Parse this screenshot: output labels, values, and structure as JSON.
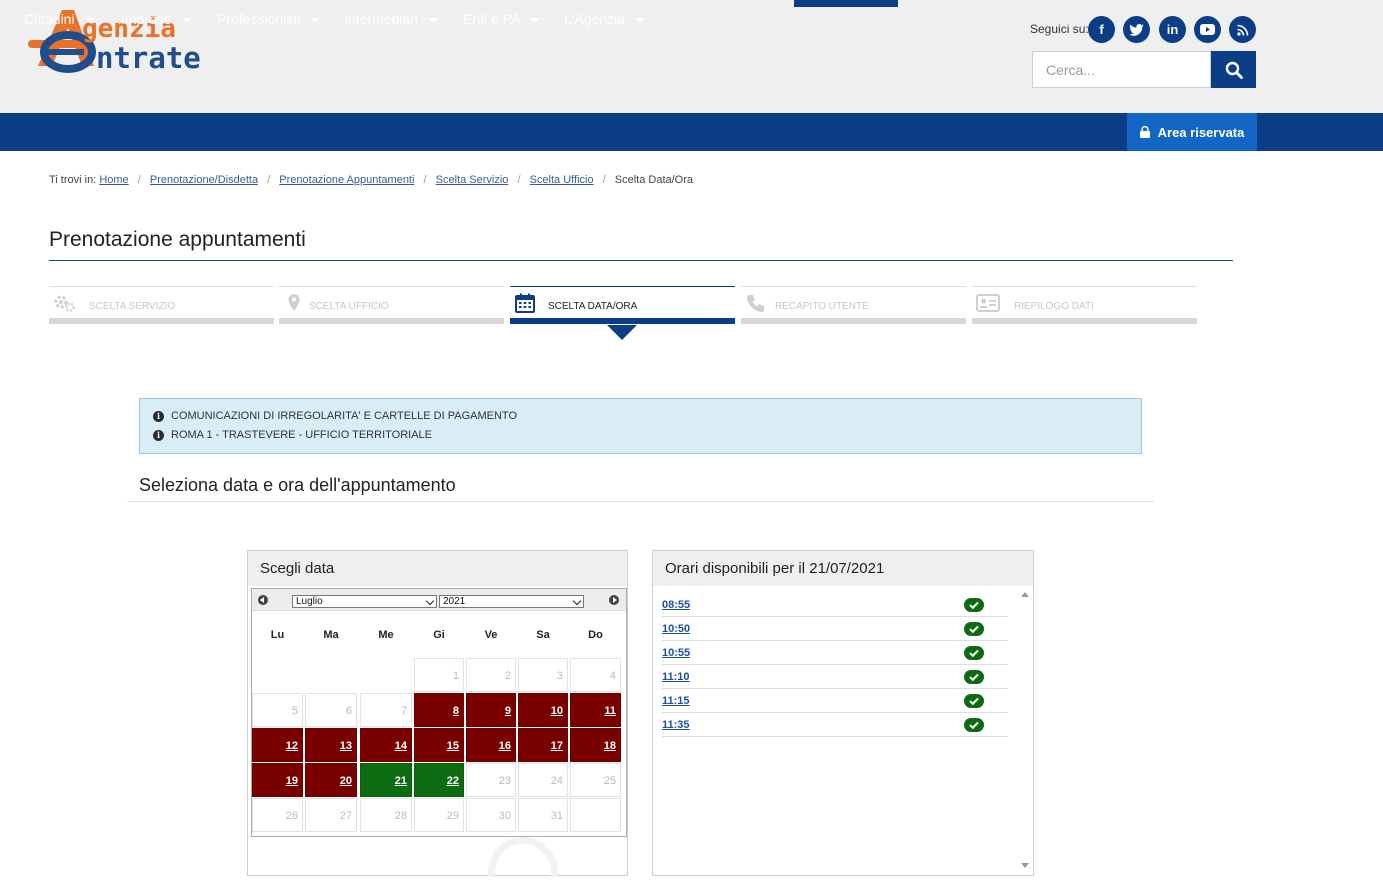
{
  "header": {
    "logo_text_line1": "genzia",
    "logo_text_line2": "ntrate",
    "social_label": "Seguici su:",
    "social_icons": [
      "facebook-icon",
      "twitter-icon",
      "linkedin-icon",
      "youtube-icon",
      "rss-icon"
    ],
    "search_placeholder": "Cerca..."
  },
  "nav": {
    "items": [
      "Cittadini",
      "Imprese",
      "Professionisti",
      "Intermediari",
      "Enti e PA",
      "L'Agenzia"
    ],
    "area_riservata": "Area riservata"
  },
  "breadcrumb": {
    "prefix": "Ti trovi in:",
    "links": [
      "Home",
      "Prenotazione/Disdetta",
      "Prenotazione Appuntamenti",
      "Scelta Servizio",
      "Scelta Ufficio"
    ],
    "current": "Scelta Data/Ora"
  },
  "page_title": "Prenotazione appuntamenti",
  "steps": [
    {
      "label": "SCELTA SERVIZIO",
      "icon": "gears-icon",
      "active": false
    },
    {
      "label": "SCELTA UFFICIO",
      "icon": "map-marker-icon",
      "active": false
    },
    {
      "label": "SCELTA DATA/ORA",
      "icon": "calendar-icon",
      "active": true
    },
    {
      "label": "RECAPITO UTENTE",
      "icon": "phone-icon",
      "active": false
    },
    {
      "label": "RIEPILOGO DATI",
      "icon": "id-card-icon",
      "active": false
    }
  ],
  "info": {
    "service": "COMUNICAZIONI DI IRREGOLARITA' E CARTELLE DI PAGAMENTO",
    "office": "ROMA 1 - TRASTEVERE - UFFICIO TERRITORIALE"
  },
  "section_title": "Seleziona data e ora dell'appuntamento",
  "date_panel": {
    "title": "Scegli data",
    "month": "Luglio",
    "year": "2021",
    "weekdays": [
      "Lu",
      "Ma",
      "Me",
      "Gi",
      "Ve",
      "Sa",
      "Do"
    ],
    "weeks": [
      [
        null,
        null,
        null,
        {
          "d": "1",
          "s": "off"
        },
        {
          "d": "2",
          "s": "off"
        },
        {
          "d": "3",
          "s": "off"
        },
        {
          "d": "4",
          "s": "off"
        }
      ],
      [
        {
          "d": "5",
          "s": "off"
        },
        {
          "d": "6",
          "s": "off"
        },
        {
          "d": "7",
          "s": "off"
        },
        {
          "d": "8",
          "s": "full"
        },
        {
          "d": "9",
          "s": "full"
        },
        {
          "d": "10",
          "s": "full"
        },
        {
          "d": "11",
          "s": "full"
        }
      ],
      [
        {
          "d": "12",
          "s": "full"
        },
        {
          "d": "13",
          "s": "full"
        },
        {
          "d": "14",
          "s": "full"
        },
        {
          "d": "15",
          "s": "full"
        },
        {
          "d": "16",
          "s": "full"
        },
        {
          "d": "17",
          "s": "full"
        },
        {
          "d": "18",
          "s": "full"
        }
      ],
      [
        {
          "d": "19",
          "s": "full"
        },
        {
          "d": "20",
          "s": "full"
        },
        {
          "d": "21",
          "s": "free"
        },
        {
          "d": "22",
          "s": "free"
        },
        {
          "d": "23",
          "s": "off"
        },
        {
          "d": "24",
          "s": "off"
        },
        {
          "d": "25",
          "s": "off"
        }
      ],
      [
        {
          "d": "26",
          "s": "off"
        },
        {
          "d": "27",
          "s": "off"
        },
        {
          "d": "28",
          "s": "off"
        },
        {
          "d": "29",
          "s": "off"
        },
        {
          "d": "30",
          "s": "off"
        },
        {
          "d": "31",
          "s": "off"
        },
        {
          "d": "",
          "s": "off"
        }
      ]
    ],
    "colors": {
      "full": "#7a0000",
      "free": "#0d6b12"
    }
  },
  "times_panel": {
    "title": "Orari disponibili per il 21/07/2021",
    "slots": [
      "08:55",
      "10:50",
      "10:55",
      "11:10",
      "11:15",
      "11:35"
    ]
  }
}
